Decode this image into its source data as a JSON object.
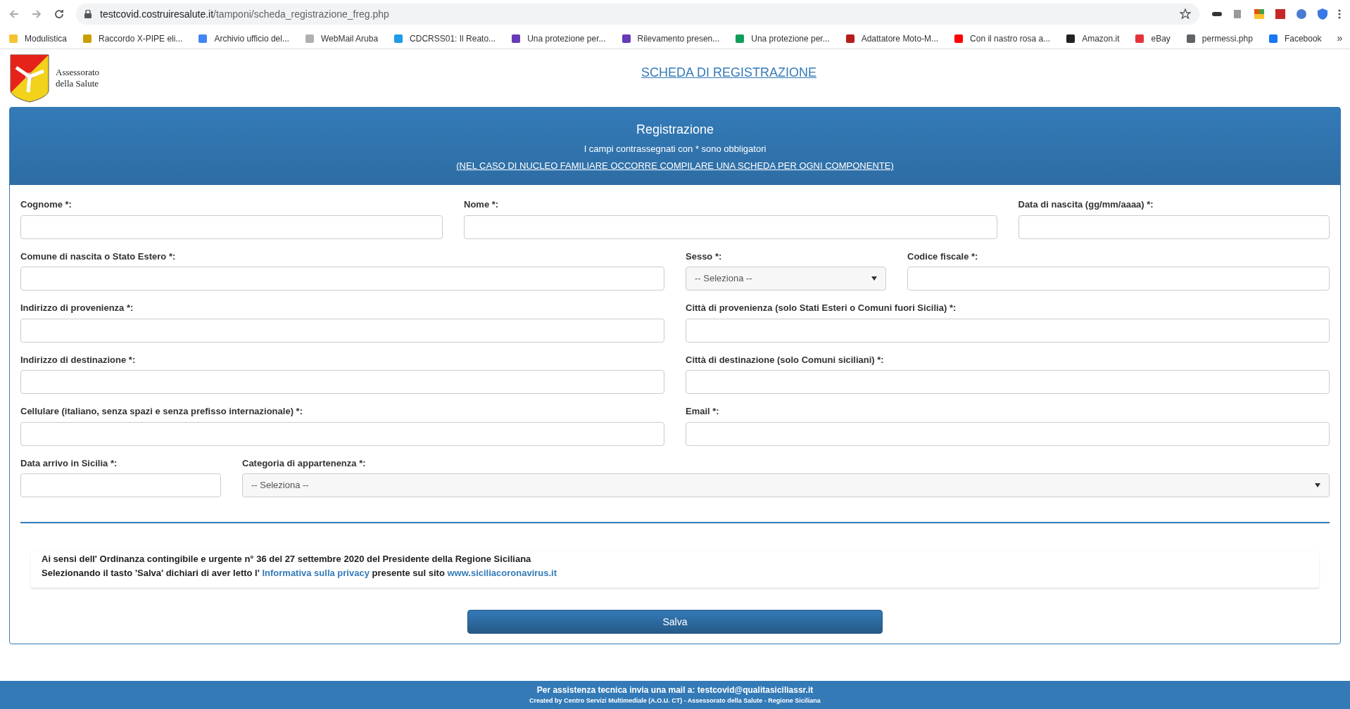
{
  "browser": {
    "url_host": "testcovid.costruiresalute.it",
    "url_path": "/tamponi/scheda_registrazione_freg.php",
    "bookmarks": [
      {
        "label": "Modulistica",
        "color": "#f4c430"
      },
      {
        "label": "Raccordo X-PIPE eli...",
        "color": "#c8a000"
      },
      {
        "label": "Archivio ufficio del...",
        "color": "#4285f4"
      },
      {
        "label": "WebMail Aruba",
        "color": "#b0b0b0"
      },
      {
        "label": "CDCRSS01: Il Reato...",
        "color": "#1e9be9"
      },
      {
        "label": "Una protezione per...",
        "color": "#673ab7"
      },
      {
        "label": "Rilevamento presen...",
        "color": "#673ab7"
      },
      {
        "label": "Una protezione per...",
        "color": "#0f9d58"
      },
      {
        "label": "Adattatore Moto-M...",
        "color": "#b71c1c"
      },
      {
        "label": "Con il nastro rosa a...",
        "color": "#ff0000"
      },
      {
        "label": "Amazon.it",
        "color": "#222222"
      },
      {
        "label": "eBay",
        "color": "#e53238"
      },
      {
        "label": "permessi.php",
        "color": "#5f6368"
      },
      {
        "label": "Facebook",
        "color": "#1877f2"
      }
    ],
    "overflow": "»"
  },
  "header": {
    "logo_line1": "Assessorato",
    "logo_line2": "della Salute",
    "title_link": "SCHEDA DI REGISTRAZIONE"
  },
  "panel": {
    "title": "Registrazione",
    "subtitle": "I campi contrassegnati con * sono obbligatori",
    "notice_link": "(NEL CASO DI NUCLEO FAMILIARE OCCORRE COMPILARE UNA SCHEDA PER OGNI COMPONENTE)"
  },
  "form_rows": [
    [
      {
        "label": "Cognome *:",
        "kind": "text"
      },
      {
        "label": "Nome *:",
        "kind": "text"
      },
      {
        "label": "Data di nascita (gg/mm/aaaa) *:",
        "kind": "text"
      }
    ],
    [
      {
        "label": "Comune di nascita o Stato Estero *:",
        "kind": "text"
      },
      {
        "label": "Sesso *:",
        "kind": "select",
        "value": "-- Seleziona --"
      },
      {
        "label": "Codice fiscale *:",
        "kind": "text"
      }
    ],
    [
      {
        "label": "Indirizzo di provenienza *:",
        "kind": "text"
      },
      {
        "label": "Città di provenienza (solo Stati Esteri o Comuni fuori Sicilia) *:",
        "kind": "text"
      }
    ],
    [
      {
        "label": "Indirizzo di destinazione *:",
        "kind": "text"
      },
      {
        "label": "Città di destinazione (solo Comuni siciliani) *:",
        "kind": "text"
      }
    ],
    [
      {
        "label": "Cellulare (italiano, senza spazi e senza prefisso internazionale) *:",
        "kind": "text"
      },
      {
        "label": "Email *:",
        "kind": "text"
      }
    ],
    [
      {
        "label": "Data arrivo in Sicilia *:",
        "kind": "text"
      },
      {
        "label": "Categoria di appartenenza *:",
        "kind": "select",
        "value": "-- Seleziona --"
      }
    ]
  ],
  "privacy": {
    "line1": "Ai sensi dell' Ordinanza contingibile e urgente n° 36 del 27 settembre 2020 del Presidente della Regione Siciliana",
    "line2_before": "Selezionando il tasto 'Salva' dichiari di aver letto l'",
    "privacy_link": "Informativa sulla privacy",
    "line2_middle": "presente sul sito",
    "site_link": "www.siciliacoronavirus.it"
  },
  "save_button": "Salva",
  "footer": {
    "line1": "Per assistenza tecnica invia una mail a: testcovid@qualitasiciliassr.it",
    "line2": "Created by Centro Servizi Multimediale (A.O.U. CT) - Assessorato della Salute - Regione Siciliana"
  }
}
